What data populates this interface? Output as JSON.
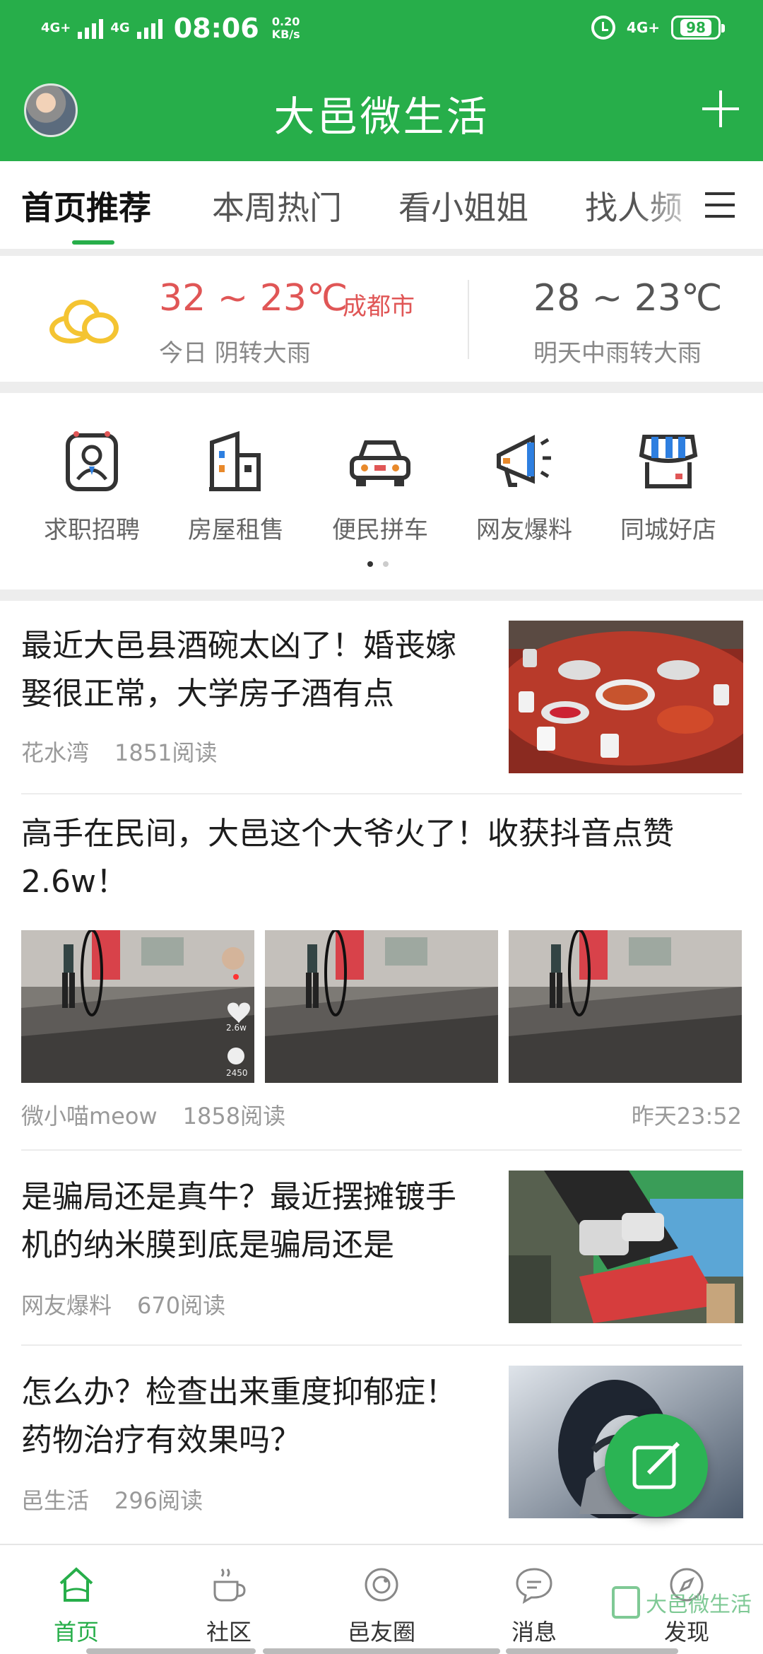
{
  "status_bar": {
    "network_left": "4G+",
    "network_left2": "4G",
    "time": "08:06",
    "speed_value": "0.20",
    "speed_unit": "KB/s",
    "network_right": "4G+",
    "battery": "98"
  },
  "header": {
    "title": "大邑微生活"
  },
  "tabs": [
    "首页推荐",
    "本周热门",
    "看小姐姐",
    "找人频"
  ],
  "weather": {
    "today_range": "32 ~ 23℃",
    "city": "成都市",
    "today_desc": "今日 阴转大雨",
    "tomorrow_range": "28 ~ 23℃",
    "tomorrow_desc": "明天中雨转大雨"
  },
  "quick_links": [
    "求职招聘",
    "房屋租售",
    "便民拼车",
    "网友爆料",
    "同城好店"
  ],
  "articles": [
    {
      "title": "最近大邑县酒碗太凶了！婚丧嫁娶很正常，大学房子酒有点",
      "author": "花水湾",
      "reads": "1851阅读"
    },
    {
      "title": "高手在民间，大邑这个大爷火了！收获抖音点赞2.6w！",
      "author": "微小喵meow",
      "reads": "1858阅读",
      "time": "昨天23:52",
      "overlay_likes": "2.6w",
      "overlay_comments": "2450"
    },
    {
      "title": "是骗局还是真牛？最近摆摊镀手机的纳米膜到底是骗局还是",
      "author": "网友爆料",
      "reads": "670阅读"
    },
    {
      "title": "怎么办？检查出来重度抑郁症！药物治疗有效果吗？",
      "author": "邑生活",
      "reads": "296阅读"
    }
  ],
  "bottom_nav": [
    "首页",
    "社区",
    "邑友圈",
    "消息",
    "发现"
  ],
  "watermark": "大邑微生活",
  "colors": {
    "brand": "#27ae4a",
    "temp_today": "#e05656"
  }
}
